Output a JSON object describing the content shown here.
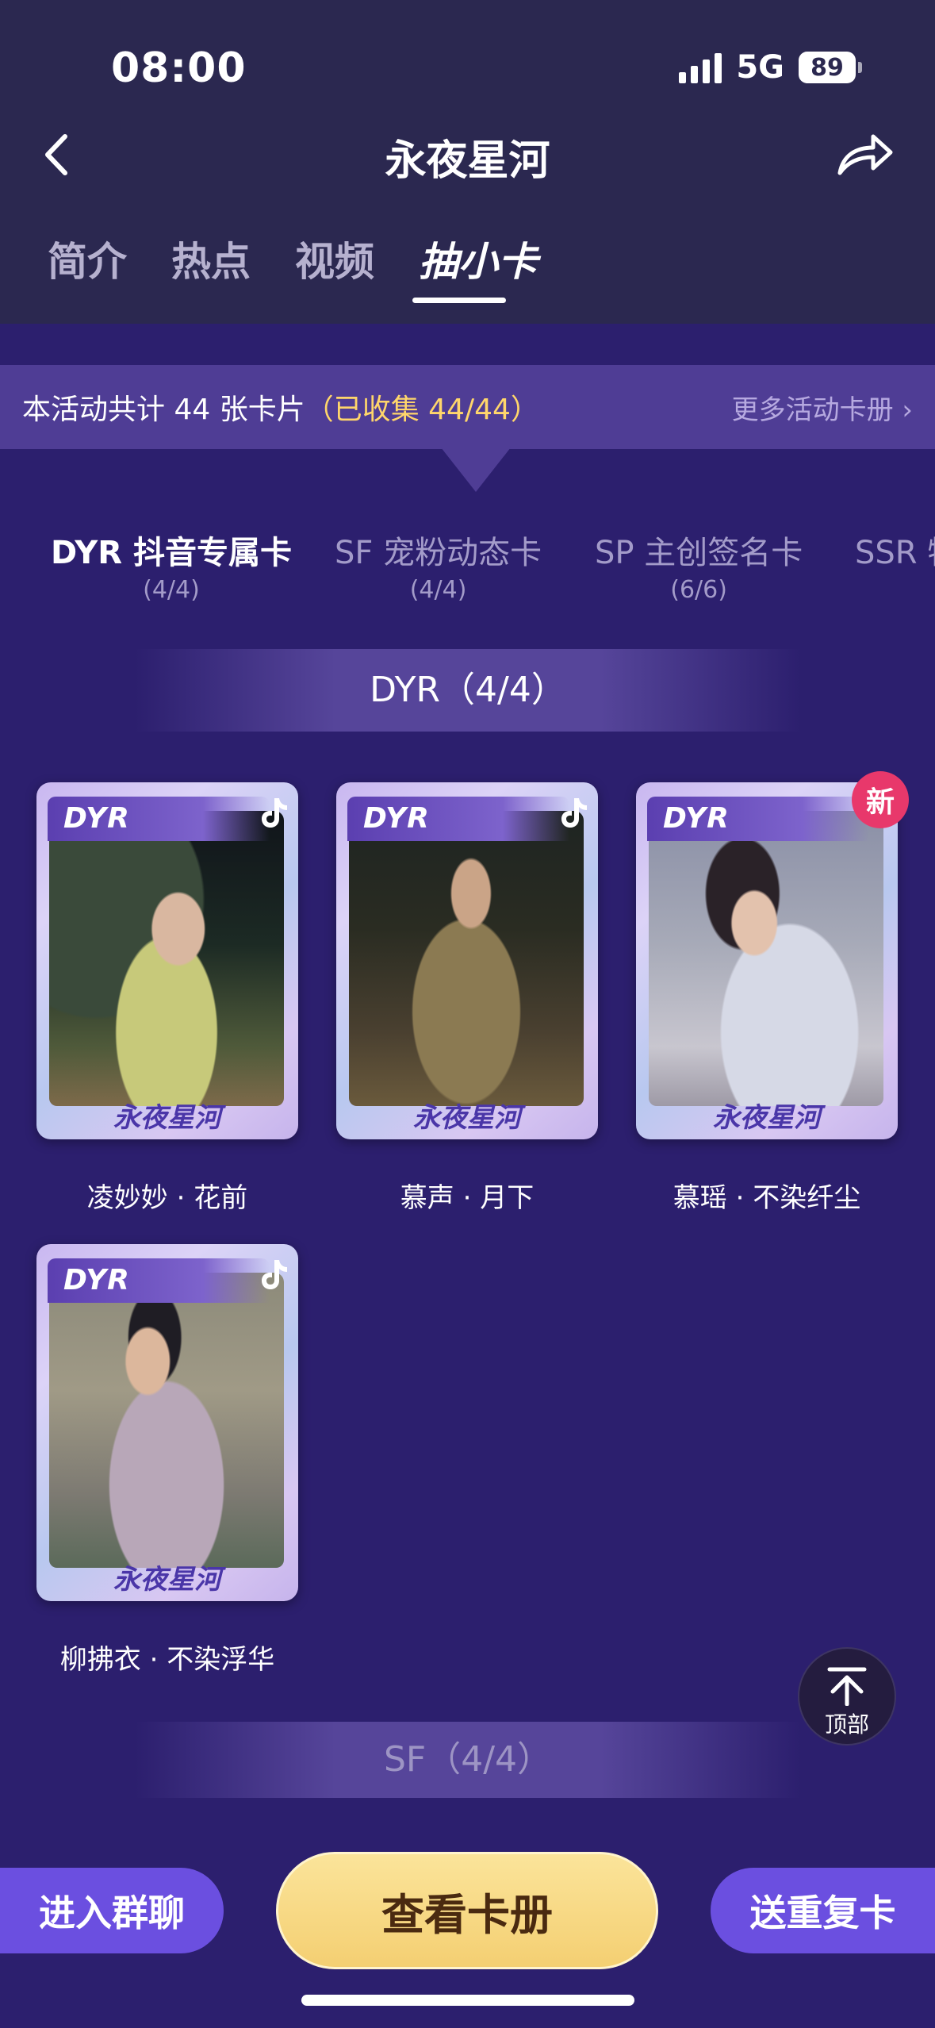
{
  "status_bar": {
    "time": "08:00",
    "network": "5G",
    "battery": "89"
  },
  "nav": {
    "title": "永夜星河"
  },
  "tabs": [
    {
      "label": "简介"
    },
    {
      "label": "热点"
    },
    {
      "label": "视频"
    },
    {
      "label": "抽小卡"
    }
  ],
  "banner": {
    "text": "本活动共计 44 张卡片",
    "collected": "（已收集 44/44）",
    "more_link": "更多活动卡册 ›"
  },
  "categories": [
    {
      "name": "DYR 抖音专属卡",
      "count": "(4/4)"
    },
    {
      "name": "SF 宠粉动态卡",
      "count": "(4/4)"
    },
    {
      "name": "SP 主创签名卡",
      "count": "(6/6)"
    },
    {
      "name": "SSR 特",
      "count": ""
    }
  ],
  "sections": {
    "dyr": "DYR（4/4）",
    "sf": "SF（4/4）"
  },
  "cards": [
    {
      "tag": "DYR",
      "name": "凌妙妙 · 花前",
      "logo": "永夜星河",
      "is_new": false
    },
    {
      "tag": "DYR",
      "name": "慕声 · 月下",
      "logo": "永夜星河",
      "is_new": false
    },
    {
      "tag": "DYR",
      "name": "慕瑶 · 不染纤尘",
      "logo": "永夜星河",
      "is_new": true,
      "badge": "新"
    },
    {
      "tag": "DYR",
      "name": "柳拂衣 · 不染浮华",
      "logo": "永夜星河",
      "is_new": false
    }
  ],
  "to_top": {
    "label": "顶部"
  },
  "bottom": {
    "left_button": "进入群聊",
    "center_button": "查看卡册",
    "right_button": "送重复卡"
  }
}
